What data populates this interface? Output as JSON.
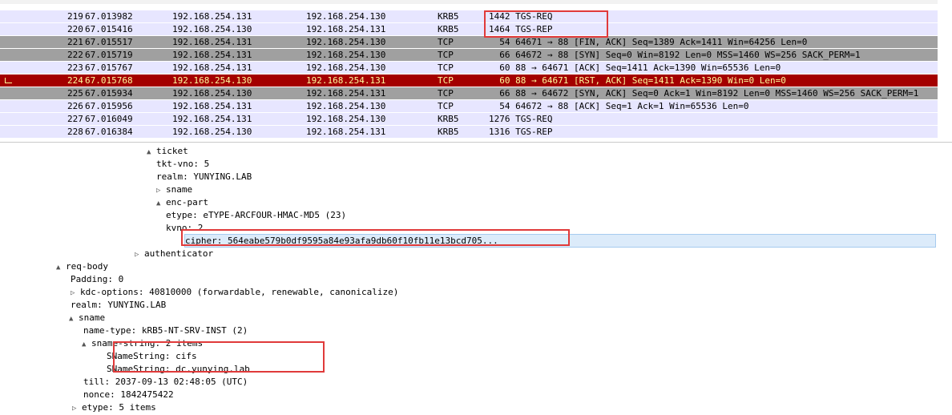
{
  "packets": [
    {
      "no": "219",
      "time": "67.013982",
      "src": "192.168.254.131",
      "dst": "192.168.254.130",
      "proto": "KRB5",
      "info": "1442 TGS-REQ",
      "style": "kerb"
    },
    {
      "no": "220",
      "time": "67.015416",
      "src": "192.168.254.130",
      "dst": "192.168.254.131",
      "proto": "KRB5",
      "info": "1464 TGS-REP",
      "style": "kerb"
    },
    {
      "no": "221",
      "time": "67.015517",
      "src": "192.168.254.131",
      "dst": "192.168.254.130",
      "proto": "TCP",
      "info": "  54 64671 → 88 [FIN, ACK] Seq=1389 Ack=1411 Win=64256 Len=0",
      "style": "tcp-gray"
    },
    {
      "no": "222",
      "time": "67.015719",
      "src": "192.168.254.131",
      "dst": "192.168.254.130",
      "proto": "TCP",
      "info": "  66 64672 → 88 [SYN] Seq=0 Win=8192 Len=0 MSS=1460 WS=256 SACK_PERM=1",
      "style": "tcp-gray"
    },
    {
      "no": "223",
      "time": "67.015767",
      "src": "192.168.254.131",
      "dst": "192.168.254.130",
      "proto": "TCP",
      "info": "  60 88 → 64671 [ACK] Seq=1411 Ack=1390 Win=65536 Len=0",
      "style": "tcp-light"
    },
    {
      "no": "224",
      "time": "67.015768",
      "src": "192.168.254.130",
      "dst": "192.168.254.131",
      "proto": "TCP",
      "info": "  60 88 → 64671 [RST, ACK] Seq=1411 Ack=1390 Win=0 Len=0",
      "style": "rst"
    },
    {
      "no": "225",
      "time": "67.015934",
      "src": "192.168.254.130",
      "dst": "192.168.254.131",
      "proto": "TCP",
      "info": "  66 88 → 64672 [SYN, ACK] Seq=0 Ack=1 Win=8192 Len=0 MSS=1460 WS=256 SACK_PERM=1",
      "style": "tcp-gray"
    },
    {
      "no": "226",
      "time": "67.015956",
      "src": "192.168.254.131",
      "dst": "192.168.254.130",
      "proto": "TCP",
      "info": "  54 64672 → 88 [ACK] Seq=1 Ack=1 Win=65536 Len=0",
      "style": "tcp-light"
    },
    {
      "no": "227",
      "time": "67.016049",
      "src": "192.168.254.131",
      "dst": "192.168.254.130",
      "proto": "KRB5",
      "info": "1276 TGS-REQ",
      "style": "kerb"
    },
    {
      "no": "228",
      "time": "67.016384",
      "src": "192.168.254.130",
      "dst": "192.168.254.131",
      "proto": "KRB5",
      "info": "1316 TGS-REP",
      "style": "kerb"
    }
  ],
  "details": [
    {
      "arrow": "▲",
      "text": "ticket"
    },
    {
      "arrow": "",
      "text": "tkt-vno: 5"
    },
    {
      "arrow": "",
      "text": "realm: YUNYING.LAB"
    },
    {
      "arrow": "▷",
      "text": "sname"
    },
    {
      "arrow": "▲",
      "text": "enc-part"
    },
    {
      "arrow": "",
      "text": "etype: eTYPE-ARCFOUR-HMAC-MD5 (23)"
    },
    {
      "arrow": "",
      "text": "kvno: 2"
    },
    {
      "arrow": "",
      "text": "cipher: 564eabe579b0df9595a84e93afa9db60f10fb11e13bcd705..."
    },
    {
      "arrow": "▷",
      "text": "authenticator"
    },
    {
      "arrow": "▲",
      "text": "req-body"
    },
    {
      "arrow": "",
      "text": "Padding: 0"
    },
    {
      "arrow": "▷",
      "text": "kdc-options: 40810000 (forwardable, renewable, canonicalize)"
    },
    {
      "arrow": "",
      "text": "realm: YUNYING.LAB"
    },
    {
      "arrow": "▲",
      "text": "sname"
    },
    {
      "arrow": "",
      "text": "name-type: kRB5-NT-SRV-INST (2)"
    },
    {
      "arrow": "▲",
      "text": "sname-string: 2 items"
    },
    {
      "arrow": "",
      "text": "SNameString: cifs"
    },
    {
      "arrow": "",
      "text": "SNameString: dc.yunying.lab"
    },
    {
      "arrow": "",
      "text": "till: 2037-09-13 02:48:05 (UTC)"
    },
    {
      "arrow": "",
      "text": "nonce: 1842475422"
    },
    {
      "arrow": "▷",
      "text": "etype: 5 items"
    }
  ]
}
